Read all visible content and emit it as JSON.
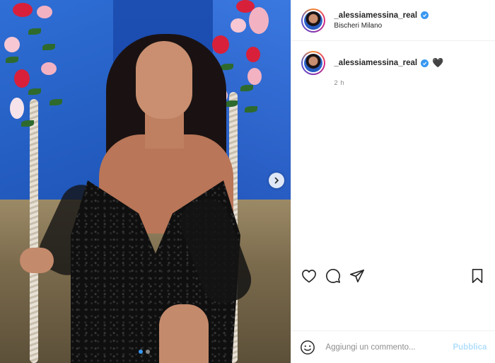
{
  "post": {
    "username": "_alessiamessina_real",
    "location": "Bischeri Milano",
    "caption_emoji": "🖤",
    "time_ago": "2 h"
  },
  "media": {
    "carousel_index": 1,
    "carousel_count": 2
  },
  "actions": {
    "like_icon": "heart-icon",
    "comment_icon": "comment-icon",
    "share_icon": "send-icon",
    "save_icon": "bookmark-icon"
  },
  "comment_box": {
    "placeholder": "Aggiungi un commento...",
    "publish_label": "Pubblica",
    "emoji_icon": "smiley-icon"
  },
  "colors": {
    "verified": "#3897f0",
    "publish_disabled": "#b2dffc",
    "secondary_text": "#8e8e8e"
  }
}
